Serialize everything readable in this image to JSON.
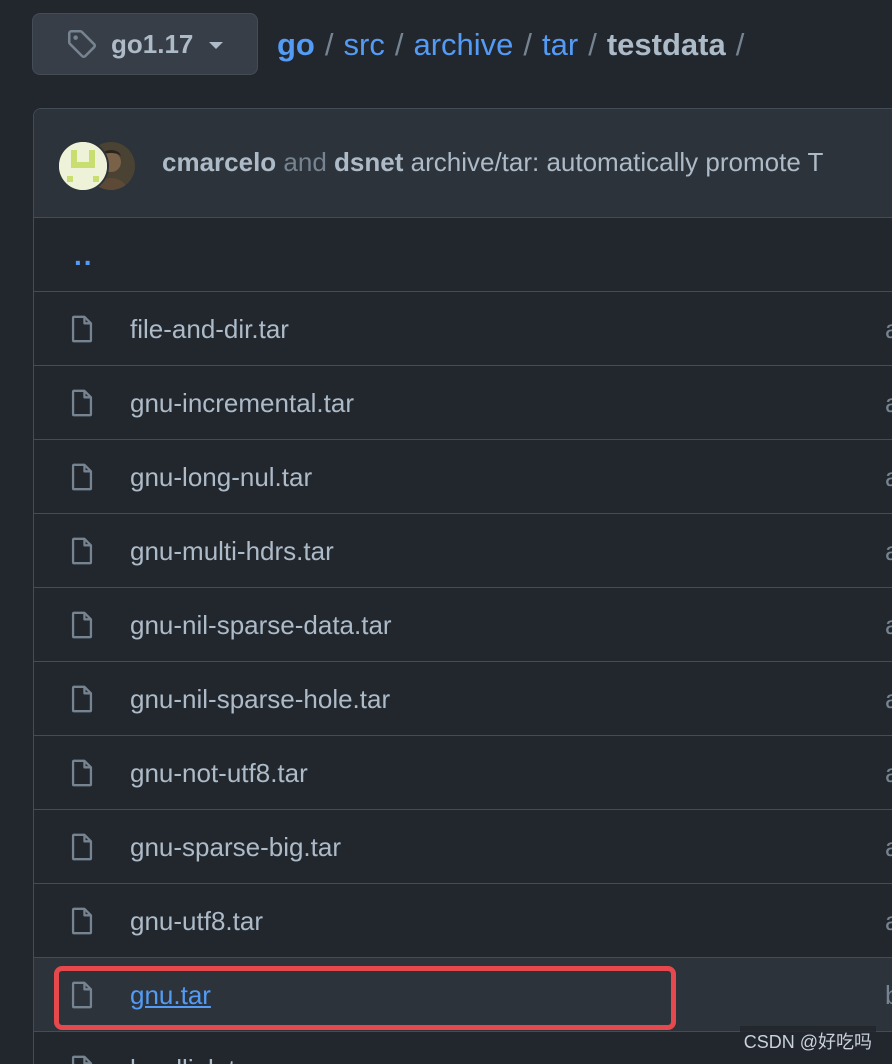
{
  "branch": {
    "icon": "tag-icon",
    "label": "go1.17"
  },
  "breadcrumb": {
    "items": [
      "go",
      "src",
      "archive",
      "tar"
    ],
    "current": "testdata",
    "separator": "/"
  },
  "commit": {
    "author1": "cmarcelo",
    "conjunction": "and",
    "author2": "dsnet",
    "message": "archive/tar: automatically promote T"
  },
  "files": {
    "parent": "..",
    "rows": [
      {
        "name": "file-and-dir.tar",
        "extra": "a"
      },
      {
        "name": "gnu-incremental.tar",
        "extra": "a"
      },
      {
        "name": "gnu-long-nul.tar",
        "extra": "a"
      },
      {
        "name": "gnu-multi-hdrs.tar",
        "extra": "a"
      },
      {
        "name": "gnu-nil-sparse-data.tar",
        "extra": "a"
      },
      {
        "name": "gnu-nil-sparse-hole.tar",
        "extra": "a"
      },
      {
        "name": "gnu-not-utf8.tar",
        "extra": "a"
      },
      {
        "name": "gnu-sparse-big.tar",
        "extra": "a"
      },
      {
        "name": "gnu-utf8.tar",
        "extra": "a"
      },
      {
        "name": "gnu.tar",
        "extra": "b"
      },
      {
        "name": "hardlink.tar",
        "extra": ""
      }
    ]
  },
  "watermark": "CSDN @好吃吗",
  "colors": {
    "background": "#22272e",
    "link": "#539bf5",
    "text": "#adbac7",
    "border": "#444c56",
    "highlight_annotation": "#e5484d"
  }
}
